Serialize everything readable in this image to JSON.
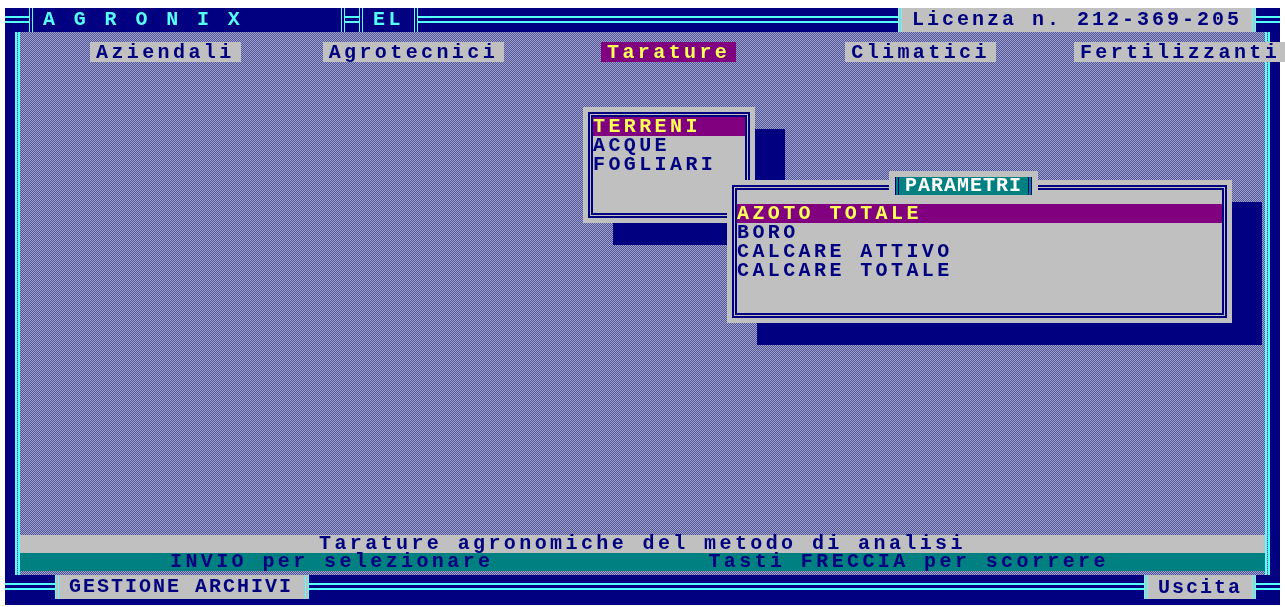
{
  "window": {
    "title": "A G R O N I X",
    "tag": "EL",
    "license": "Licenza n. 212-369-205"
  },
  "menu": [
    {
      "label": "Aziendali",
      "selected": false
    },
    {
      "label": "Agrotecnici",
      "selected": false
    },
    {
      "label": "Tarature",
      "selected": true
    },
    {
      "label": "Climatici",
      "selected": false
    },
    {
      "label": "Fertilizzanti",
      "selected": false
    }
  ],
  "submenu": {
    "items": [
      {
        "label": "TERRENI",
        "selected": true
      },
      {
        "label": "ACQUE",
        "selected": false
      },
      {
        "label": "FOGLIARI",
        "selected": false
      }
    ]
  },
  "parameters": {
    "title": "PARAMETRI",
    "items": [
      {
        "label": "AZOTO TOTALE",
        "selected": true
      },
      {
        "label": "BORO",
        "selected": false
      },
      {
        "label": "CALCARE ATTIVO",
        "selected": false
      },
      {
        "label": "CALCARE TOTALE",
        "selected": false
      }
    ]
  },
  "status": {
    "description": "Tarature agronomiche del metodo di analisi",
    "hints": [
      "INVIO per selezionare",
      "Tasti FRECCIA per scorrere"
    ]
  },
  "bottom": {
    "section": "GESTIONE ARCHIVI",
    "exit": "Uscita"
  }
}
